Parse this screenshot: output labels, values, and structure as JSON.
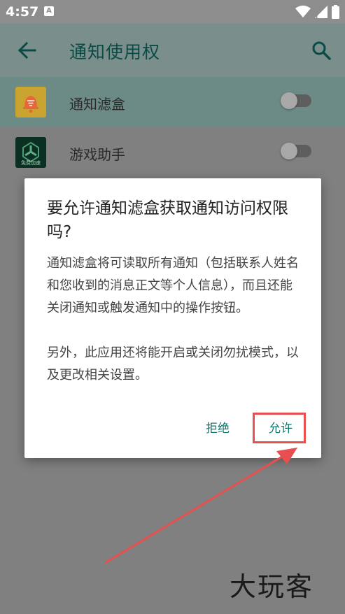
{
  "status_bar": {
    "time": "4:57",
    "notification_icon": "a-icon",
    "icons": [
      "wifi-icon",
      "cell-signal-icon",
      "battery-icon"
    ]
  },
  "app_bar": {
    "title": "通知使用权",
    "back_icon": "arrow-left-icon",
    "search_icon": "search-icon"
  },
  "list": [
    {
      "label": "通知滤盒",
      "icon": "bell-filter-icon",
      "enabled": false
    },
    {
      "label": "游戏助手",
      "icon": "game-helper-icon",
      "icon_text": "免费加速",
      "enabled": false
    }
  ],
  "dialog": {
    "title": "要允许通知滤盒获取通知访问权限吗?",
    "body_1": "通知滤盒将可读取所有通知（包括联系人姓名和您收到的消息正文等个人信息），而且还能关闭通知或触发通知中的操作按钮。",
    "body_2": "另外，此应用还将能开启或关闭勿扰模式，以及更改相关设置。",
    "deny_label": "拒绝",
    "allow_label": "允许"
  },
  "watermark": "大玩客",
  "colors": {
    "accent": "#10786e",
    "highlight": "#e84f50"
  }
}
